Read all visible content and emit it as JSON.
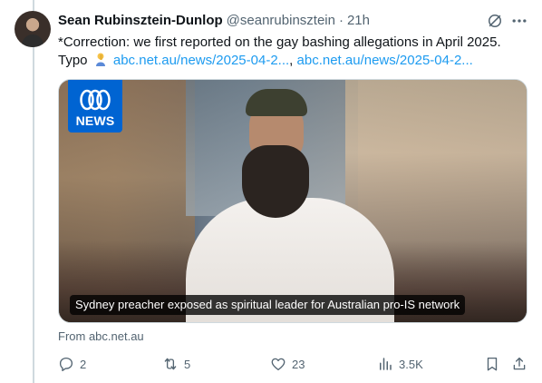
{
  "tweet": {
    "display_name": "Sean Rubinsztein-Dunlop",
    "handle": "@seanrubinsztein",
    "separator": "·",
    "time": "21h",
    "text_line1": "*Correction: we first reported on the gay bashing allegations in April 2025.",
    "text_prefix": "Typo",
    "emoji": "person-facepalming-emoji",
    "link1": "abc.net.au/news/2025-04-2...",
    "link_separator": ",",
    "link2": "abc.net.au/news/2025-04-2..."
  },
  "media": {
    "logo_text": "NEWS",
    "caption": "Sydney preacher exposed as spiritual leader for Australian pro-IS network",
    "source": "From abc.net.au"
  },
  "actions": {
    "replies": "2",
    "reposts": "5",
    "likes": "23",
    "views": "3.5K"
  },
  "icons": {
    "header": [
      "grok-icon",
      "more-icon"
    ],
    "actions": [
      "reply-icon",
      "repost-icon",
      "like-icon",
      "views-icon",
      "bookmark-icon",
      "share-icon"
    ]
  },
  "colors": {
    "link": "#1d9bf0",
    "secondary_text": "#536471",
    "abc_blue": "#0064d2"
  }
}
